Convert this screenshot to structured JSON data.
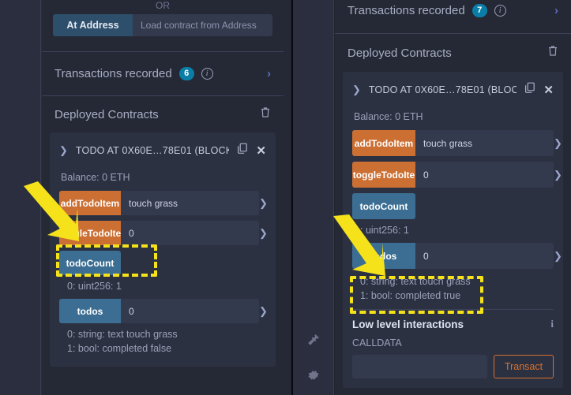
{
  "left_panel": {
    "or_label": "OR",
    "at_address": {
      "button_label": "At Address",
      "input_placeholder": "Load contract from Address",
      "input_value": ""
    },
    "transactions": {
      "label": "Transactions recorded",
      "count": "6",
      "info_icon": "info-icon",
      "chevron_icon": "chevron-right-icon"
    },
    "deployed_contracts": {
      "title": "Deployed Contracts",
      "trash_icon": "trash-icon"
    },
    "contract": {
      "caret_icon": "chevron-down-icon",
      "name": "TODO AT 0X60E…78E01 (BLOCK(",
      "copy_icon": "copy-icon",
      "close_icon": "close-icon",
      "balance": "Balance: 0 ETH",
      "functions": [
        {
          "label": "addTodoItem",
          "kind": "payable",
          "input_value": "touch grass",
          "caret_icon": "chevron-down-icon"
        },
        {
          "label": "toggleTodoIte",
          "kind": "payable",
          "input_value": "0",
          "caret_icon": "chevron-down-icon"
        },
        {
          "label": "todoCount",
          "kind": "view",
          "input_value": null,
          "caret_icon": null
        }
      ],
      "todo_count_result": "0: uint256: 1",
      "todos": {
        "label": "todos",
        "kind": "view",
        "input_value": "0",
        "caret_icon": "chevron-down-icon"
      },
      "todos_results": [
        "0: string: text touch grass",
        "1: bool: completed false"
      ]
    }
  },
  "icon_rail": {
    "plug_icon": "plug-icon",
    "gear_icon": "gear-icon"
  },
  "right_panel": {
    "transactions": {
      "label": "Transactions recorded",
      "count": "7",
      "info_icon": "info-icon",
      "chevron_icon": "chevron-right-icon"
    },
    "deployed_contracts": {
      "title": "Deployed Contracts",
      "trash_icon": "trash-icon"
    },
    "contract": {
      "caret_icon": "chevron-down-icon",
      "name": "TODO AT 0X60E…78E01 (BLOCK(",
      "copy_icon": "copy-icon",
      "close_icon": "close-icon",
      "balance": "Balance: 0 ETH",
      "functions": [
        {
          "label": "addTodoItem",
          "kind": "payable",
          "input_value": "touch grass",
          "caret_icon": "chevron-down-icon"
        },
        {
          "label": "toggleTodoIte",
          "kind": "payable",
          "input_value": "0",
          "caret_icon": "chevron-down-icon"
        },
        {
          "label": "todoCount",
          "kind": "view",
          "input_value": null,
          "caret_icon": null
        }
      ],
      "todo_count_result": ": uint256: 1",
      "todos": {
        "label": "todos",
        "kind": "view",
        "input_value": "0",
        "caret_icon": "chevron-down-icon"
      },
      "todos_results": [
        "0: string: text touch grass",
        "1: bool: completed true"
      ]
    },
    "low_level": {
      "title": "Low level interactions",
      "info_icon": "info-icon",
      "calldata_label": "CALLDATA",
      "calldata_value": "",
      "transact_label": "Transact"
    }
  },
  "annotations": {
    "highlight_color": "#f5e21a",
    "arrow_left": "arrow-pointing-to-toggleTodoItem",
    "arrow_right": "arrow-pointing-to-todos",
    "box_left": "highlight-toggleTodoItem-row",
    "box_right": "highlight-todos-results"
  },
  "colors": {
    "payable_button": "#cc6f33",
    "view_button": "#3b6e92",
    "badge": "#0b7ea8",
    "transact_border": "#d4712f",
    "panel_bg": "#252936"
  }
}
